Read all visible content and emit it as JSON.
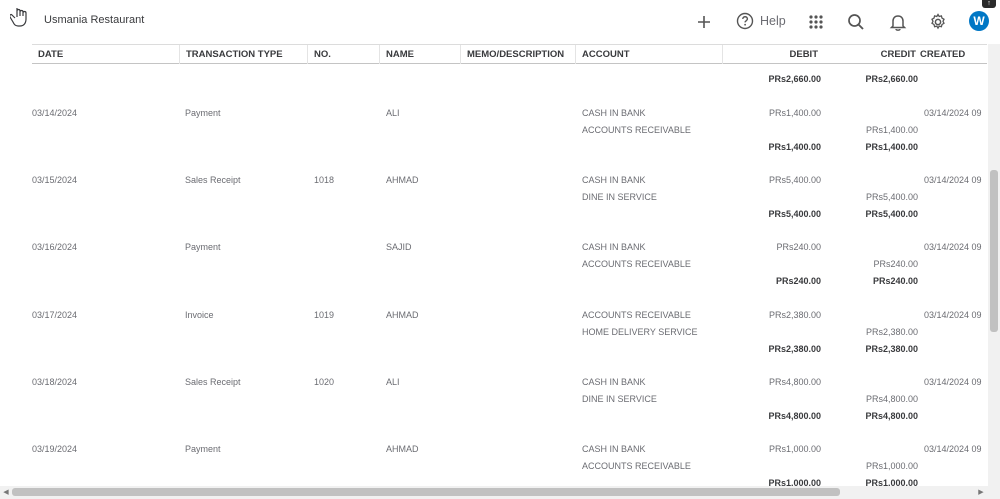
{
  "app": {
    "title": "Usmania Restaurant",
    "user_initial": "W",
    "help_label": "Help"
  },
  "columns": [
    "DATE",
    "TRANSACTION TYPE",
    "NO.",
    "NAME",
    "MEMO/DESCRIPTION",
    "ACCOUNT",
    "DEBIT",
    "CREDIT",
    "CREATED"
  ],
  "partial_top": {
    "debit": "PRs2,660.00",
    "credit": "PRs2,660.00"
  },
  "transactions": [
    {
      "date": "03/14/2024",
      "type": "Payment",
      "no": "",
      "name": "ALI",
      "lines": [
        {
          "account": "CASH IN BANK",
          "debit": "PRs1,400.00",
          "credit": ""
        },
        {
          "account": "ACCOUNTS RECEIVABLE",
          "debit": "",
          "credit": "PRs1,400.00"
        }
      ],
      "total_debit": "PRs1,400.00",
      "total_credit": "PRs1,400.00",
      "created": "03/14/2024 09"
    },
    {
      "date": "03/15/2024",
      "type": "Sales Receipt",
      "no": "1018",
      "name": "AHMAD",
      "lines": [
        {
          "account": "CASH IN BANK",
          "debit": "PRs5,400.00",
          "credit": ""
        },
        {
          "account": "DINE IN SERVICE",
          "debit": "",
          "credit": "PRs5,400.00"
        }
      ],
      "total_debit": "PRs5,400.00",
      "total_credit": "PRs5,400.00",
      "created": "03/14/2024 09"
    },
    {
      "date": "03/16/2024",
      "type": "Payment",
      "no": "",
      "name": "SAJID",
      "lines": [
        {
          "account": "CASH IN BANK",
          "debit": "PRs240.00",
          "credit": ""
        },
        {
          "account": "ACCOUNTS RECEIVABLE",
          "debit": "",
          "credit": "PRs240.00"
        }
      ],
      "total_debit": "PRs240.00",
      "total_credit": "PRs240.00",
      "created": "03/14/2024 09"
    },
    {
      "date": "03/17/2024",
      "type": "Invoice",
      "no": "1019",
      "name": "AHMAD",
      "lines": [
        {
          "account": "ACCOUNTS RECEIVABLE",
          "debit": "PRs2,380.00",
          "credit": ""
        },
        {
          "account": "HOME DELIVERY SERVICE",
          "debit": "",
          "credit": "PRs2,380.00"
        }
      ],
      "total_debit": "PRs2,380.00",
      "total_credit": "PRs2,380.00",
      "created": "03/14/2024 09"
    },
    {
      "date": "03/18/2024",
      "type": "Sales Receipt",
      "no": "1020",
      "name": "ALI",
      "lines": [
        {
          "account": "CASH IN BANK",
          "debit": "PRs4,800.00",
          "credit": ""
        },
        {
          "account": "DINE IN SERVICE",
          "debit": "",
          "credit": "PRs4,800.00"
        }
      ],
      "total_debit": "PRs4,800.00",
      "total_credit": "PRs4,800.00",
      "created": "03/14/2024 09"
    },
    {
      "date": "03/19/2024",
      "type": "Payment",
      "no": "",
      "name": "AHMAD",
      "lines": [
        {
          "account": "CASH IN BANK",
          "debit": "PRs1,000.00",
          "credit": ""
        },
        {
          "account": "ACCOUNTS RECEIVABLE",
          "debit": "",
          "credit": "PRs1,000.00"
        }
      ],
      "total_debit": "PRs1,000.00",
      "total_credit": "PRs1,000.00",
      "created": "03/14/2024 09"
    }
  ],
  "icons": {
    "add": "plus-icon",
    "help": "question-circle-icon",
    "apps": "grid-icon",
    "search": "search-icon",
    "notifications": "bell-icon",
    "settings": "gear-icon"
  },
  "colors": {
    "accent": "#0077c5",
    "text": "#393a3d",
    "muted": "#6b6c72"
  }
}
